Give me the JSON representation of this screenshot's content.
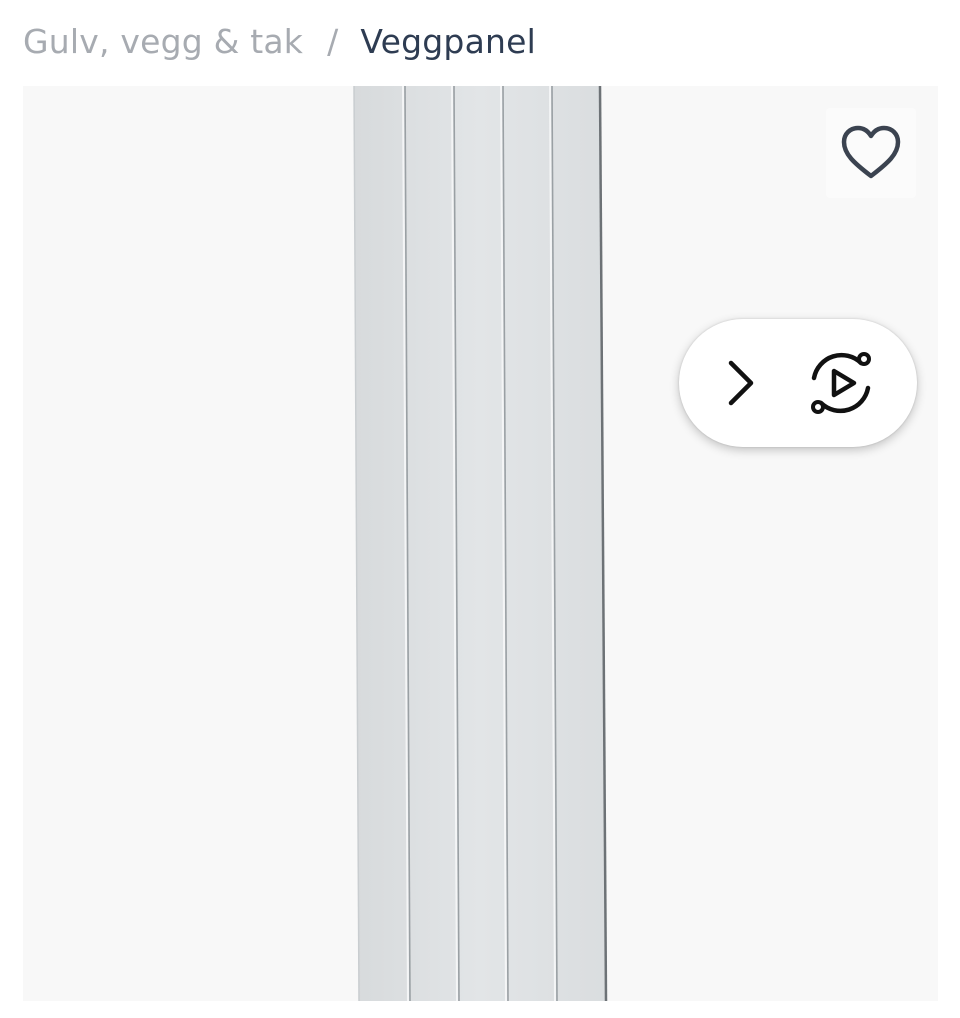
{
  "breadcrumb": {
    "parent": "Gulv, vegg & tak",
    "separator": "/",
    "current": "Veggpanel"
  },
  "gallery": {
    "image_alt": "Veggpanel",
    "icons": {
      "favorite": "heart-icon",
      "next": "chevron-right-icon",
      "video": "rotate-play-icon"
    }
  },
  "colors": {
    "breadcrumb_muted": "#a7abb1",
    "breadcrumb_active": "#2e3c52",
    "gallery_background": "#f8f8f8",
    "panel": "#dfe2e4",
    "heart_stroke": "#3b4350"
  }
}
